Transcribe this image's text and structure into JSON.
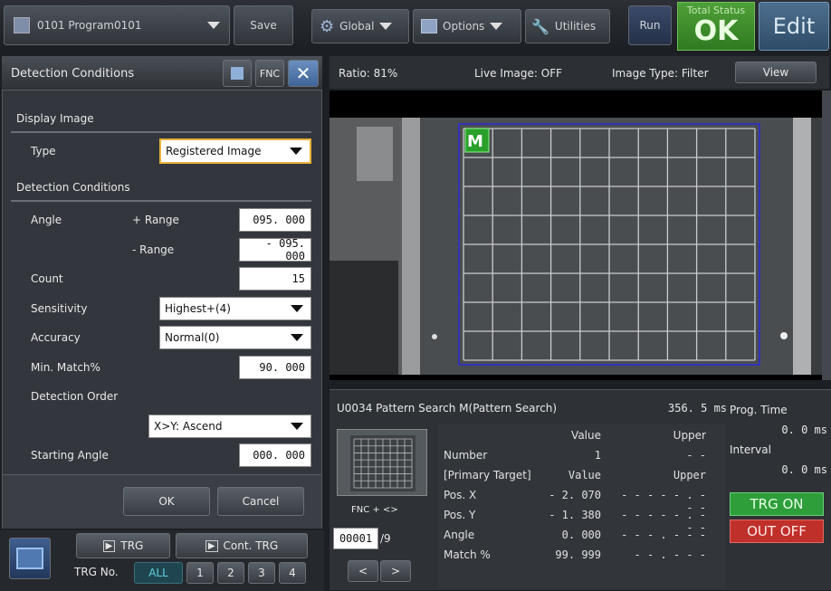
{
  "toolbar": {
    "program": "0101  Program0101",
    "save": "Save",
    "global": "Global",
    "options": "Options",
    "utilities": "Utilities",
    "run": "Run",
    "total_status_label": "Total Status",
    "total_status_value": "OK",
    "edit": "Edit"
  },
  "panel": {
    "title": "Detection  Conditions",
    "fnc": "FNC",
    "display_image": "Display  Image",
    "type_label": "Type",
    "type_value": "Registered  Image",
    "detection_conditions": "Detection  Conditions",
    "angle_label": "Angle",
    "plus_range_label": "+  Range",
    "plus_range_value": "095. 000",
    "minus_range_label": "-  Range",
    "minus_range_value": "- 095. 000",
    "count_label": "Count",
    "count_value": "15",
    "sensitivity_label": "Sensitivity",
    "sensitivity_value": "Highest+(4)",
    "accuracy_label": "Accuracy",
    "accuracy_value": "Normal(0)",
    "min_match_label": "Min.  Match%",
    "min_match_value": "90. 000",
    "detection_order_label": "Detection  Order",
    "detection_order_value": "X>Y:  Ascend",
    "starting_angle_label": "Starting  Angle",
    "starting_angle_value": "000. 000",
    "ok": "OK",
    "cancel": "Cancel"
  },
  "trigger": {
    "trg": "TRG",
    "cont_trg": "Cont. TRG",
    "trg_no_label": "TRG  No.",
    "trg_nos": [
      "ALL",
      "1",
      "2",
      "3",
      "4"
    ]
  },
  "viewer": {
    "ratio": "Ratio:  81%",
    "live_image": "Live  Image:  OFF",
    "image_type": "Image  Type:  Filter",
    "view": "View",
    "marker_label": "M"
  },
  "result": {
    "unit": "U0034  Pattern  Search  M(Pattern  Search)",
    "time": "356. 5 ms",
    "prog_time_label": "Prog.  Time",
    "prog_time_value": "0. 0 ms",
    "interval_label": "Interval",
    "interval_value": "0. 0 ms",
    "fnc_nav": "FNC  +  <>",
    "page_current": "00001",
    "page_total": "/9",
    "prev": "<",
    "next": ">",
    "trg_on": "TRG ON",
    "out_off": "OUT OFF",
    "col_value": "Value",
    "col_upper": "Upper",
    "rows": [
      {
        "label": "Number",
        "value": "1",
        "upper": "- -"
      },
      {
        "label": "[Primary  Target]",
        "value": "Value",
        "upper": "Upper"
      },
      {
        "label": "Pos.  X",
        "value": "- 2. 070",
        "upper": "- - - - - . - - -"
      },
      {
        "label": "Pos.  Y",
        "value": "- 1. 380",
        "upper": "- - - - - . - - -"
      },
      {
        "label": "Angle",
        "value": "0. 000",
        "upper": "- - - . - - -"
      },
      {
        "label": "Match  %",
        "value": "99. 999",
        "upper": "- - . - - -"
      }
    ]
  },
  "colors": {
    "ok_green": "#3e8a2a",
    "trg_on": "#2e9e3a",
    "out_off": "#c0302a",
    "roi_blue": "#2b2bd8",
    "field_highlight": "#e8b23a"
  }
}
